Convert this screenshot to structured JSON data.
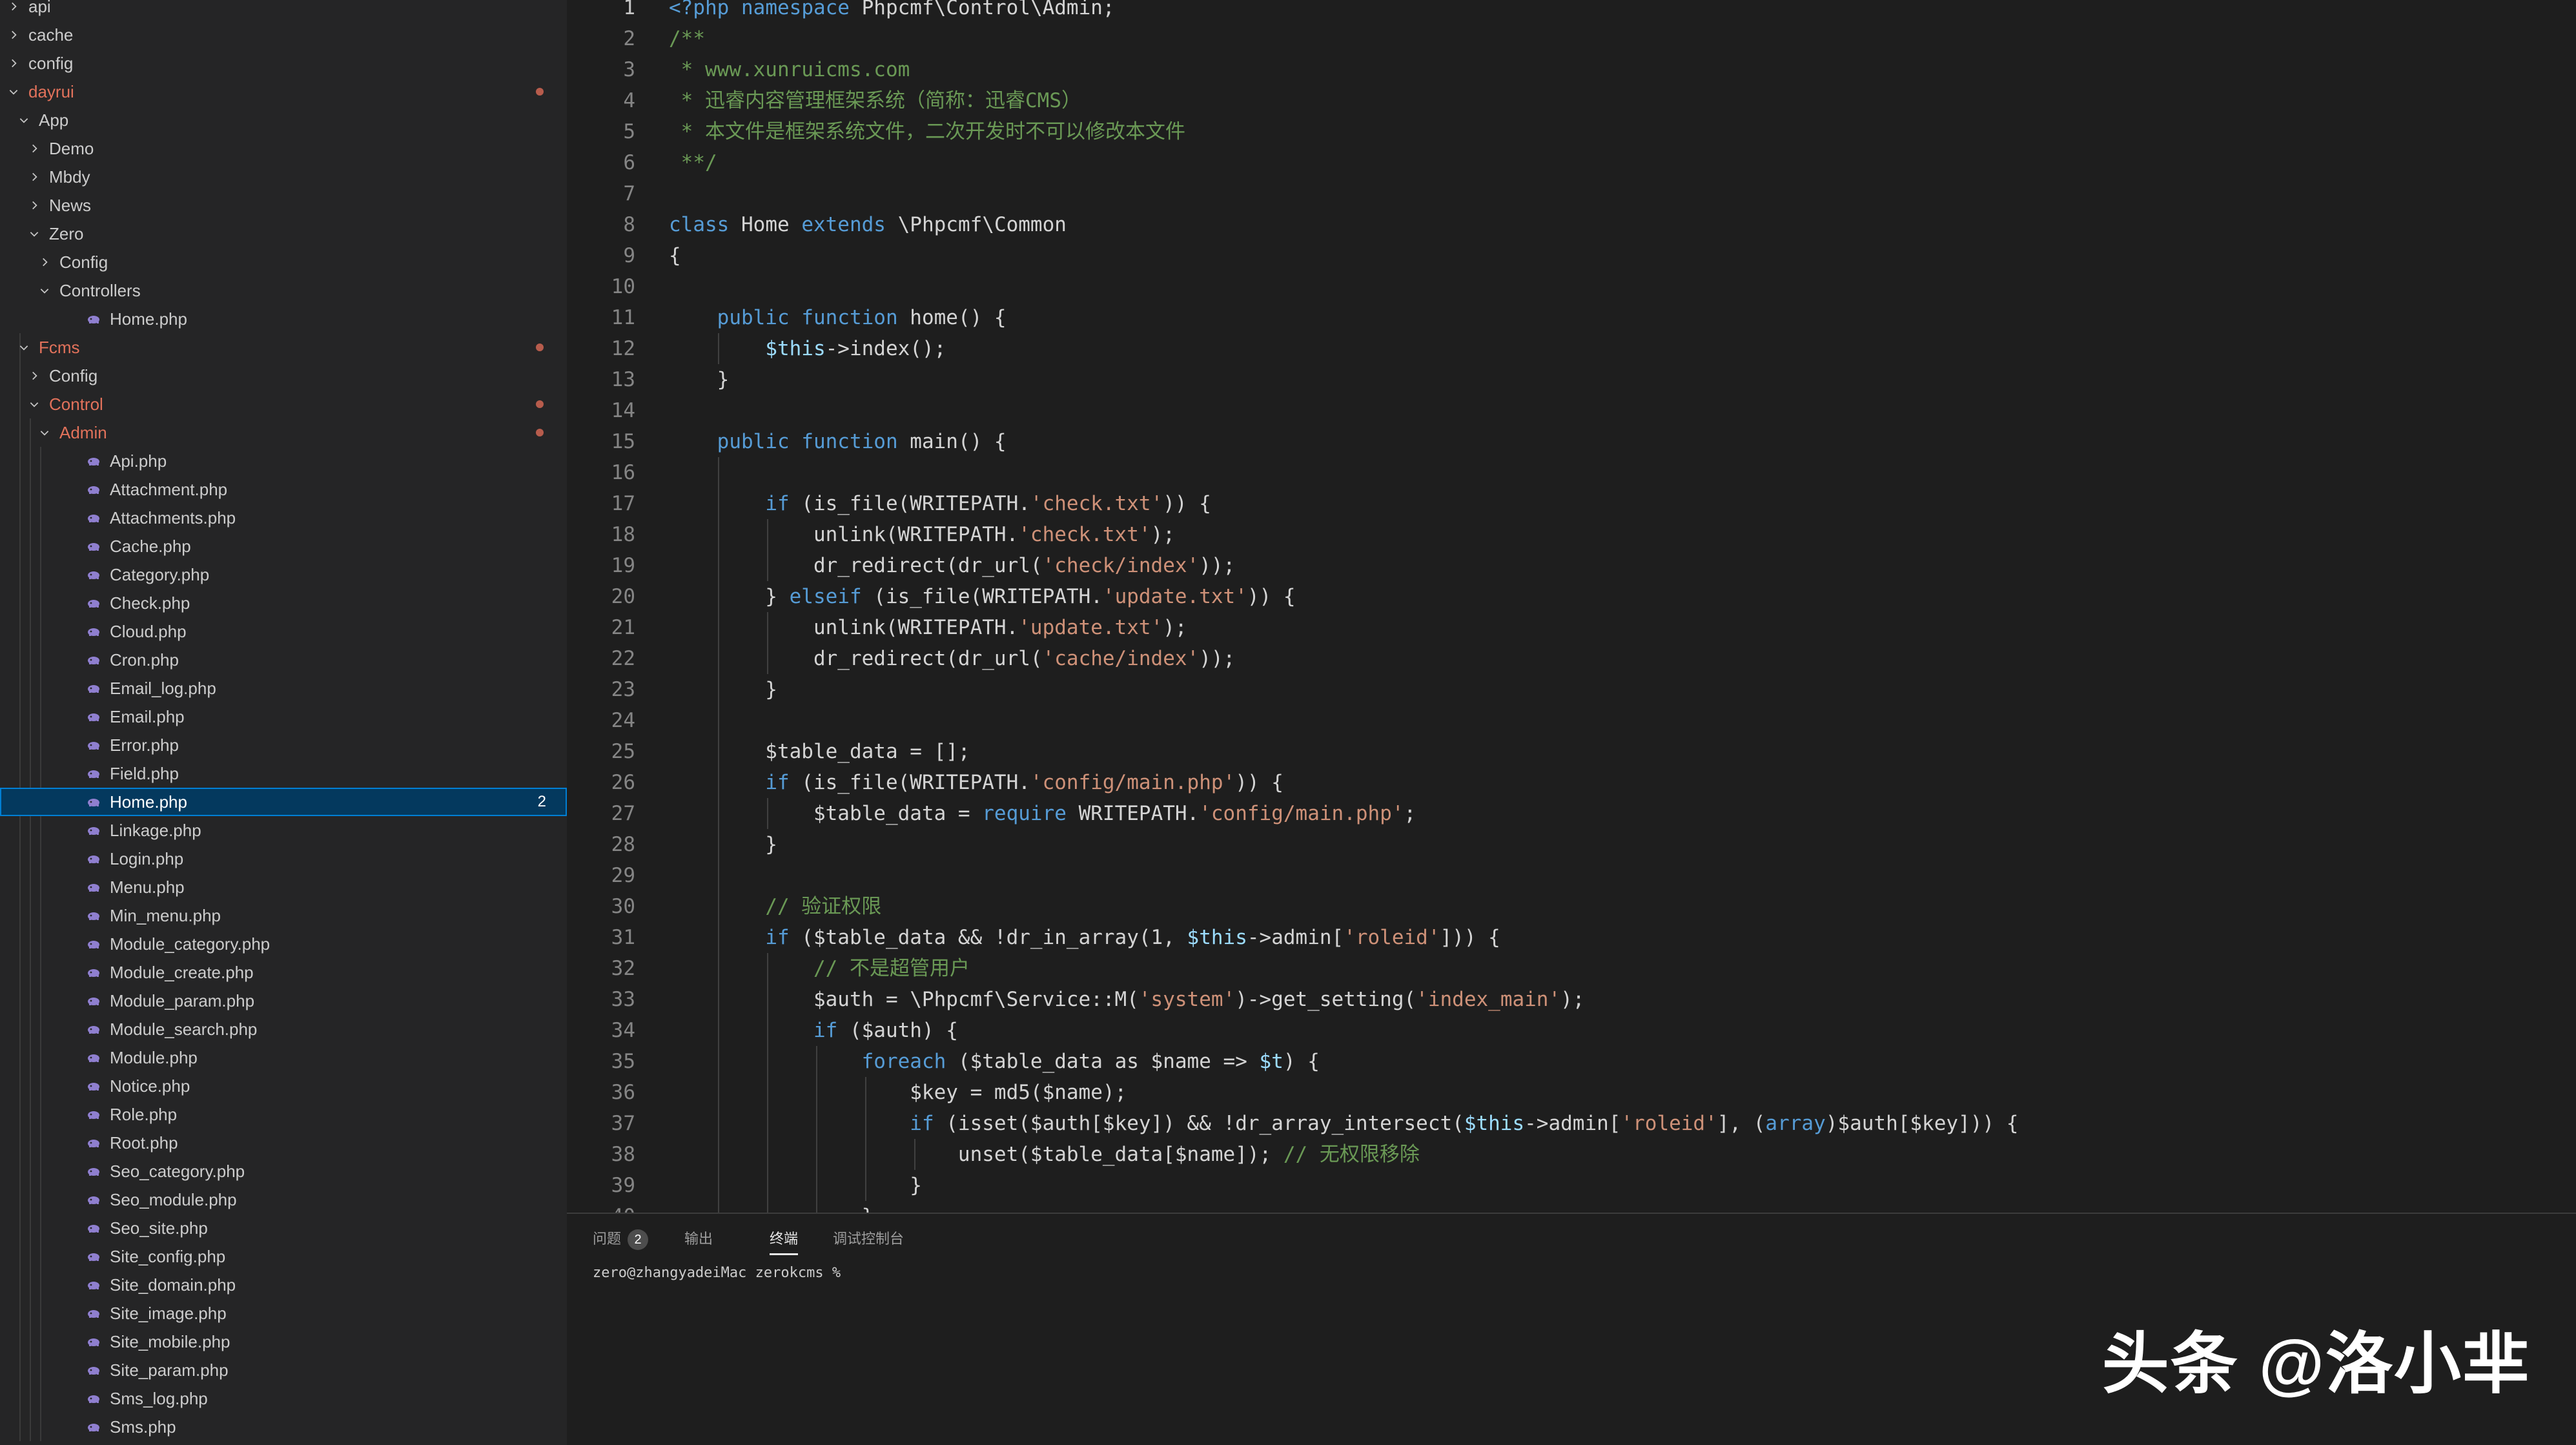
{
  "explorer": {
    "items": [
      {
        "label": "api",
        "depth": 0,
        "type": "folder",
        "open": false
      },
      {
        "label": "cache",
        "depth": 0,
        "type": "folder",
        "open": false
      },
      {
        "label": "config",
        "depth": 0,
        "type": "folder",
        "open": false
      },
      {
        "label": "dayrui",
        "depth": 0,
        "type": "folder",
        "open": true,
        "modified": true
      },
      {
        "label": "App",
        "depth": 1,
        "type": "folder",
        "open": true
      },
      {
        "label": "Demo",
        "depth": 2,
        "type": "folder",
        "open": false
      },
      {
        "label": "Mbdy",
        "depth": 2,
        "type": "folder",
        "open": false
      },
      {
        "label": "News",
        "depth": 2,
        "type": "folder",
        "open": false
      },
      {
        "label": "Zero",
        "depth": 2,
        "type": "folder",
        "open": true
      },
      {
        "label": "Config",
        "depth": 3,
        "type": "folder",
        "open": false
      },
      {
        "label": "Controllers",
        "depth": 3,
        "type": "folder",
        "open": true
      },
      {
        "label": "Home.php",
        "depth": 4,
        "type": "file"
      },
      {
        "label": "Fcms",
        "depth": 1,
        "type": "folder",
        "open": true,
        "modified": true
      },
      {
        "label": "Config",
        "depth": 2,
        "type": "folder",
        "open": false
      },
      {
        "label": "Control",
        "depth": 2,
        "type": "folder",
        "open": true,
        "modified": true
      },
      {
        "label": "Admin",
        "depth": 3,
        "type": "folder",
        "open": true,
        "modified": true
      },
      {
        "label": "Api.php",
        "depth": 4,
        "type": "file"
      },
      {
        "label": "Attachment.php",
        "depth": 4,
        "type": "file"
      },
      {
        "label": "Attachments.php",
        "depth": 4,
        "type": "file"
      },
      {
        "label": "Cache.php",
        "depth": 4,
        "type": "file"
      },
      {
        "label": "Category.php",
        "depth": 4,
        "type": "file"
      },
      {
        "label": "Check.php",
        "depth": 4,
        "type": "file"
      },
      {
        "label": "Cloud.php",
        "depth": 4,
        "type": "file"
      },
      {
        "label": "Cron.php",
        "depth": 4,
        "type": "file"
      },
      {
        "label": "Email_log.php",
        "depth": 4,
        "type": "file"
      },
      {
        "label": "Email.php",
        "depth": 4,
        "type": "file"
      },
      {
        "label": "Error.php",
        "depth": 4,
        "type": "file"
      },
      {
        "label": "Field.php",
        "depth": 4,
        "type": "file"
      },
      {
        "label": "Home.php",
        "depth": 4,
        "type": "file",
        "selected": true,
        "badge": "2"
      },
      {
        "label": "Linkage.php",
        "depth": 4,
        "type": "file"
      },
      {
        "label": "Login.php",
        "depth": 4,
        "type": "file"
      },
      {
        "label": "Menu.php",
        "depth": 4,
        "type": "file"
      },
      {
        "label": "Min_menu.php",
        "depth": 4,
        "type": "file"
      },
      {
        "label": "Module_category.php",
        "depth": 4,
        "type": "file"
      },
      {
        "label": "Module_create.php",
        "depth": 4,
        "type": "file"
      },
      {
        "label": "Module_param.php",
        "depth": 4,
        "type": "file"
      },
      {
        "label": "Module_search.php",
        "depth": 4,
        "type": "file"
      },
      {
        "label": "Module.php",
        "depth": 4,
        "type": "file"
      },
      {
        "label": "Notice.php",
        "depth": 4,
        "type": "file"
      },
      {
        "label": "Role.php",
        "depth": 4,
        "type": "file"
      },
      {
        "label": "Root.php",
        "depth": 4,
        "type": "file"
      },
      {
        "label": "Seo_category.php",
        "depth": 4,
        "type": "file"
      },
      {
        "label": "Seo_module.php",
        "depth": 4,
        "type": "file"
      },
      {
        "label": "Seo_site.php",
        "depth": 4,
        "type": "file"
      },
      {
        "label": "Site_config.php",
        "depth": 4,
        "type": "file"
      },
      {
        "label": "Site_domain.php",
        "depth": 4,
        "type": "file"
      },
      {
        "label": "Site_image.php",
        "depth": 4,
        "type": "file"
      },
      {
        "label": "Site_mobile.php",
        "depth": 4,
        "type": "file"
      },
      {
        "label": "Site_param.php",
        "depth": 4,
        "type": "file"
      },
      {
        "label": "Sms_log.php",
        "depth": 4,
        "type": "file"
      },
      {
        "label": "Sms.php",
        "depth": 4,
        "type": "file"
      }
    ]
  },
  "editor": {
    "current_line": 1,
    "lines": [
      {
        "n": "1",
        "indent": 0,
        "tokens": [
          [
            "kw",
            "<?php"
          ],
          [
            "",
            " "
          ],
          [
            "kw",
            "namespace"
          ],
          [
            "",
            " Phpcmf\\Control\\Admin;"
          ]
        ]
      },
      {
        "n": "2",
        "indent": 0,
        "tokens": [
          [
            "cm",
            "/**"
          ]
        ]
      },
      {
        "n": "3",
        "indent": 0,
        "tokens": [
          [
            "cm",
            " * www.xunruicms.com"
          ]
        ]
      },
      {
        "n": "4",
        "indent": 0,
        "tokens": [
          [
            "cm",
            " * 迅睿内容管理框架系统（简称：迅睿CMS）"
          ]
        ]
      },
      {
        "n": "5",
        "indent": 0,
        "tokens": [
          [
            "cm",
            " * 本文件是框架系统文件，二次开发时不可以修改本文件"
          ]
        ]
      },
      {
        "n": "6",
        "indent": 0,
        "tokens": [
          [
            "cm",
            " **/"
          ]
        ]
      },
      {
        "n": "7",
        "indent": 0,
        "tokens": []
      },
      {
        "n": "8",
        "indent": 0,
        "tokens": [
          [
            "kw",
            "class"
          ],
          [
            "",
            " Home "
          ],
          [
            "kw",
            "extends"
          ],
          [
            "",
            " \\Phpcmf\\Common"
          ]
        ]
      },
      {
        "n": "9",
        "indent": 0,
        "tokens": [
          [
            "",
            "{"
          ]
        ]
      },
      {
        "n": "10",
        "indent": 1,
        "tokens": []
      },
      {
        "n": "11",
        "indent": 1,
        "tokens": [
          [
            "",
            "    "
          ],
          [
            "kw",
            "public"
          ],
          [
            "",
            " "
          ],
          [
            "kw",
            "function"
          ],
          [
            "",
            " home() {"
          ]
        ]
      },
      {
        "n": "12",
        "indent": 2,
        "tokens": [
          [
            "",
            "        "
          ],
          [
            "var",
            "$this"
          ],
          [
            "",
            "->index();"
          ]
        ]
      },
      {
        "n": "13",
        "indent": 1,
        "tokens": [
          [
            "",
            "    }"
          ]
        ]
      },
      {
        "n": "14",
        "indent": 1,
        "tokens": []
      },
      {
        "n": "15",
        "indent": 1,
        "tokens": [
          [
            "",
            "    "
          ],
          [
            "kw",
            "public"
          ],
          [
            "",
            " "
          ],
          [
            "kw",
            "function"
          ],
          [
            "",
            " main() {"
          ]
        ]
      },
      {
        "n": "16",
        "indent": 2,
        "tokens": []
      },
      {
        "n": "17",
        "indent": 2,
        "tokens": [
          [
            "",
            "        "
          ],
          [
            "kw",
            "if"
          ],
          [
            "",
            " (is_file(WRITEPATH."
          ],
          [
            "str",
            "'check.txt'"
          ],
          [
            "",
            ")) {"
          ]
        ]
      },
      {
        "n": "18",
        "indent": 3,
        "tokens": [
          [
            "",
            "            unlink(WRITEPATH."
          ],
          [
            "str",
            "'check.txt'"
          ],
          [
            "",
            ");"
          ]
        ]
      },
      {
        "n": "19",
        "indent": 3,
        "tokens": [
          [
            "",
            "            dr_redirect(dr_url("
          ],
          [
            "str",
            "'check/index'"
          ],
          [
            "",
            "));"
          ]
        ]
      },
      {
        "n": "20",
        "indent": 2,
        "tokens": [
          [
            "",
            "        } "
          ],
          [
            "kw",
            "elseif"
          ],
          [
            "",
            " (is_file(WRITEPATH."
          ],
          [
            "str",
            "'update.txt'"
          ],
          [
            "",
            ")) {"
          ]
        ]
      },
      {
        "n": "21",
        "indent": 3,
        "tokens": [
          [
            "",
            "            unlink(WRITEPATH."
          ],
          [
            "str",
            "'update.txt'"
          ],
          [
            "",
            ");"
          ]
        ]
      },
      {
        "n": "22",
        "indent": 3,
        "tokens": [
          [
            "",
            "            dr_redirect(dr_url("
          ],
          [
            "str",
            "'cache/index'"
          ],
          [
            "",
            "));"
          ]
        ]
      },
      {
        "n": "23",
        "indent": 2,
        "tokens": [
          [
            "",
            "        }"
          ]
        ]
      },
      {
        "n": "24",
        "indent": 2,
        "tokens": []
      },
      {
        "n": "25",
        "indent": 2,
        "tokens": [
          [
            "",
            "        $table_data = [];"
          ]
        ]
      },
      {
        "n": "26",
        "indent": 2,
        "tokens": [
          [
            "",
            "        "
          ],
          [
            "kw",
            "if"
          ],
          [
            "",
            " (is_file(WRITEPATH."
          ],
          [
            "str",
            "'config/main.php'"
          ],
          [
            "",
            ")) {"
          ]
        ]
      },
      {
        "n": "27",
        "indent": 3,
        "tokens": [
          [
            "",
            "            $table_data = "
          ],
          [
            "kw",
            "require"
          ],
          [
            "",
            " WRITEPATH."
          ],
          [
            "str",
            "'config/main.php'"
          ],
          [
            "",
            ";"
          ]
        ]
      },
      {
        "n": "28",
        "indent": 2,
        "tokens": [
          [
            "",
            "        }"
          ]
        ]
      },
      {
        "n": "29",
        "indent": 2,
        "tokens": []
      },
      {
        "n": "30",
        "indent": 2,
        "tokens": [
          [
            "",
            "        "
          ],
          [
            "cm",
            "// 验证权限"
          ]
        ]
      },
      {
        "n": "31",
        "indent": 2,
        "tokens": [
          [
            "",
            "        "
          ],
          [
            "kw",
            "if"
          ],
          [
            "",
            " ($table_data && !dr_in_array(1, "
          ],
          [
            "var",
            "$this"
          ],
          [
            "",
            "->admin["
          ],
          [
            "str",
            "'roleid'"
          ],
          [
            "",
            "])) {"
          ]
        ]
      },
      {
        "n": "32",
        "indent": 3,
        "tokens": [
          [
            "",
            "            "
          ],
          [
            "cm",
            "// 不是超管用户"
          ]
        ]
      },
      {
        "n": "33",
        "indent": 3,
        "tokens": [
          [
            "",
            "            $auth = \\Phpcmf\\Service::M("
          ],
          [
            "str",
            "'system'"
          ],
          [
            "",
            ")->get_setting("
          ],
          [
            "str",
            "'index_main'"
          ],
          [
            "",
            ");"
          ]
        ]
      },
      {
        "n": "34",
        "indent": 3,
        "tokens": [
          [
            "",
            "            "
          ],
          [
            "kw",
            "if"
          ],
          [
            "",
            " ($auth) {"
          ]
        ]
      },
      {
        "n": "35",
        "indent": 4,
        "tokens": [
          [
            "",
            "                "
          ],
          [
            "kw",
            "foreach"
          ],
          [
            "",
            " ($table_data as $name => "
          ],
          [
            "var",
            "$t"
          ],
          [
            "",
            ") {"
          ]
        ]
      },
      {
        "n": "36",
        "indent": 5,
        "tokens": [
          [
            "",
            "                    $key = md5($name);"
          ]
        ]
      },
      {
        "n": "37",
        "indent": 5,
        "tokens": [
          [
            "",
            "                    "
          ],
          [
            "kw",
            "if"
          ],
          [
            "",
            " (isset($auth[$key]) && !dr_array_intersect("
          ],
          [
            "var",
            "$this"
          ],
          [
            "",
            "->admin["
          ],
          [
            "str",
            "'roleid'"
          ],
          [
            "",
            "], ("
          ],
          [
            "kw",
            "array"
          ],
          [
            "",
            ")$auth[$key])) {"
          ]
        ]
      },
      {
        "n": "38",
        "indent": 6,
        "tokens": [
          [
            "",
            "                        unset($table_data[$name]); "
          ],
          [
            "cm",
            "// 无权限移除"
          ]
        ]
      },
      {
        "n": "39",
        "indent": 5,
        "tokens": [
          [
            "",
            "                    }"
          ]
        ]
      },
      {
        "n": "40",
        "indent": 4,
        "tokens": [
          [
            "",
            "                }"
          ]
        ]
      }
    ]
  },
  "panel": {
    "tabs": [
      {
        "label": "问题",
        "badge": "2",
        "active": false
      },
      {
        "label": "输出",
        "active": false
      },
      {
        "label": "终端",
        "active": true
      },
      {
        "label": "调试控制台",
        "active": false
      }
    ],
    "terminal_prompt": "zero@zhangyadeiMac zerokcms % "
  },
  "watermark": "头条 @洛小芈",
  "colors": {
    "sidebar_bg": "#252526",
    "editor_bg": "#1e1e1e",
    "selection_bg": "#04395e",
    "modified_text": "#e2725b",
    "php_icon": "#8f7fcf",
    "keyword": "#569cd6",
    "string": "#ce9178",
    "comment": "#6a9955",
    "variable": "#9cdcfe"
  }
}
